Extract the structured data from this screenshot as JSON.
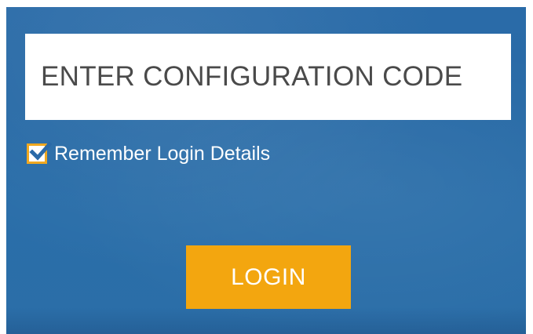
{
  "login_form": {
    "config_code_placeholder": "ENTER CONFIGURATION CODE",
    "config_code_value": "",
    "remember": {
      "label": "Remember Login Details",
      "checked": true
    },
    "login_label": "LOGIN"
  },
  "colors": {
    "background_blue": "#2a6ba8",
    "accent_orange": "#f3a60f",
    "input_text": "#4a4a4a"
  }
}
